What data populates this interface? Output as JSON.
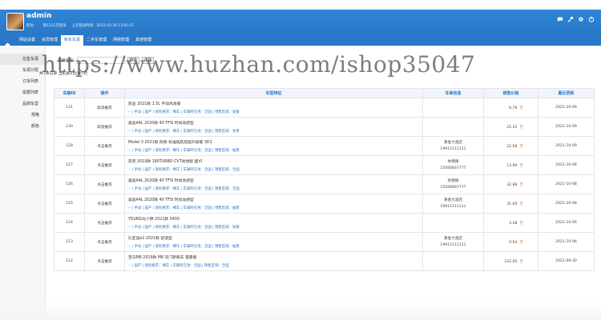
{
  "header": {
    "username": "admin",
    "info": [
      "职位：",
      "第1211次登录",
      "上次登录时间：2022-03-26 13:05:47"
    ]
  },
  "nav": {
    "tabs": [
      "网站设置",
      "会员管理",
      "新车车源",
      "二手车管理",
      "网络管理",
      "其他管理"
    ],
    "active": 2
  },
  "sidebar": {
    "items": [
      "在售车源",
      "车源分配",
      "订单列表",
      "需要列表",
      "品牌车型",
      "规格",
      "颜色"
    ]
  },
  "search": {
    "label": "车辆名称:",
    "placeholder": "",
    "search_btn": "搜索",
    "clear_btn": "清除"
  },
  "count": {
    "prefix": "共",
    "total": "1",
    "middle": "条记录 当前第1页/共",
    "pages": "1",
    "suffix": "页"
  },
  "table": {
    "headers": [
      "车辆ID",
      "操作",
      "车型特征",
      "车商信息",
      "销售价格",
      "最近更新"
    ],
    "rows": [
      {
        "id": "131",
        "op": "取消推荐",
        "title": "凯迪 2021款 1.5L 手动风尚版",
        "tags": "-- | 手动 | 国产 | 保险要求：裸车 | 车辆所在地：全国 | 销售区域：安徽",
        "shop": "",
        "phone": "",
        "price": "8.79",
        "unit": "万",
        "date": "2021-10-09"
      },
      {
        "id": "130",
        "op": "取消推荐",
        "title": "奥迪A4L 2020款 40 TFSI 时尚动感型",
        "tags": "-- | 手动 | 国产 | 保险要求：裸车 | 车辆所在地：全国 | 销售区域：甘肃",
        "shop": "",
        "phone": "",
        "price": "25.35",
        "unit": "万",
        "date": "2021-10-09"
      },
      {
        "id": "128",
        "op": "点击推荐",
        "title": "Model 3 2021款 改款 标准续航后驱升级版 3D1",
        "tags": "-- | 手动 | 国产 | 保险要求：裸车 | 车辆所在地：全国 | 销售区域：福建",
        "shop": "黄金大酒店",
        "phone": "19911111111",
        "price": "22.68",
        "unit": "万",
        "date": "2021-10-09"
      },
      {
        "id": "127",
        "op": "点击推荐",
        "title": "昂克 2019款 180TURBO CVT尚悦版 国VI",
        "tags": "-- | 手动 | 国产 | 保险要求：裸车 | 车辆所在地：全国 | 销售区域：全国",
        "shop": "你猜猜",
        "phone": "15566667777",
        "price": "13.99",
        "unit": "万",
        "date": "2021-10-08"
      },
      {
        "id": "126",
        "op": "点击推荐",
        "title": "奥迪A4L 2020款 40 TFSI 时尚动感型",
        "tags": "-- | 手动 | 国产 | 保险要求：裸车 | 车辆所在地：全国 | 销售区域：全国",
        "shop": "你猜猜",
        "phone": "15566667777",
        "price": "32.88",
        "unit": "万",
        "date": "2021-10-08"
      },
      {
        "id": "125",
        "op": "点击推荐",
        "title": "奥迪A4L 2020款 40 TFSI 时尚动感型",
        "tags": "-- | 手动 | 国产 | 保险要求：裸车 | 车辆所在地：全国 | 销售区域：福建",
        "shop": "黄金大酒店",
        "phone": "19911111111",
        "price": "31.09",
        "unit": "万",
        "date": "2021-10-08"
      },
      {
        "id": "124",
        "op": "点击推荐",
        "title": "YOUNG光小胖 2021款 5400",
        "tags": "-- | 手动 | 国产 | 保险要求：裸车 | 车辆所在地：全国 | 销售区域：安徽",
        "shop": "",
        "phone": "",
        "price": "3.48",
        "unit": "万",
        "date": "2021-10-06"
      },
      {
        "id": "123",
        "op": "点击推荐",
        "title": "比亚迪e2 2021款 舒适型",
        "tags": "-- | 手动 | 国产 | 保险要求：裸车 | 车辆所在地：全国 | 销售区域：福建",
        "shop": "黄金大酒店",
        "phone": "19911111111",
        "price": "9.64",
        "unit": "万",
        "date": "2021-10-06"
      },
      {
        "id": "122",
        "op": "点击推荐",
        "title": "宝马M8 2019款 M8 双门轿跑车 雷霆版",
        "tags": "-- | 国产 | 保险要求：裸车 | 车辆所在地：全国 | 销售区域：全国",
        "shop": "",
        "phone": "",
        "price": "232.00",
        "unit": "万",
        "date": "2021-09-30"
      }
    ]
  },
  "watermark": "https://www.huzhan.com/ishop35047"
}
